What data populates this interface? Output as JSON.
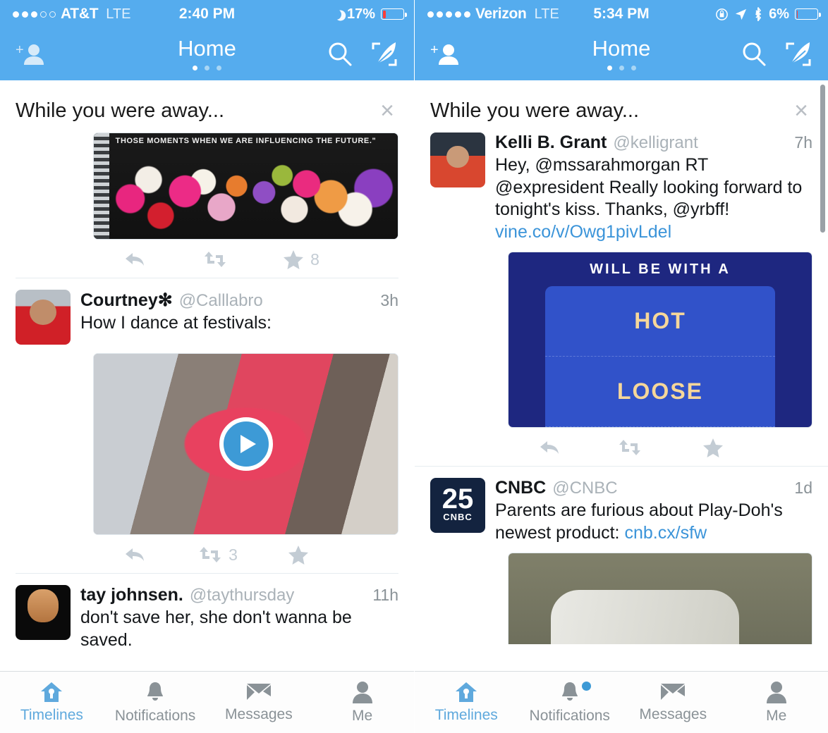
{
  "screens": [
    {
      "status": {
        "carrier": "AT&T",
        "network": "LTE",
        "time": "2:40 PM",
        "battery_percent": "17%",
        "signal_bars_filled": 3,
        "signal_bars_total": 5,
        "icons": [
          "moon-icon",
          "battery-icon"
        ],
        "battery_color": "#fc3d39"
      },
      "nav": {
        "title": "Home",
        "page_dot_active_index": 0,
        "page_dots": 3,
        "left_icon": "add-person-icon",
        "right_icons": [
          "search-icon",
          "compose-icon"
        ]
      },
      "section": {
        "title": "While you were away...",
        "close_label": "×"
      },
      "tweets": [
        {
          "name": "",
          "handle": "",
          "time": "",
          "text": "",
          "media": "flowers-notebook-image",
          "media_caption": "THOSE MOMENTS WHEN WE ARE INFLUENCING THE FUTURE.\"",
          "actions": {
            "reply": "",
            "retweet": "",
            "favorite": "8"
          }
        },
        {
          "name": "Courtney✻",
          "handle": "@Calllabro",
          "time": "3h",
          "text": "How I dance at festivals:",
          "media": "dance-video",
          "actions": {
            "reply": "",
            "retweet": "3",
            "favorite": ""
          }
        },
        {
          "name": "tay johnsen.",
          "handle": "@taythursday",
          "time": "11h",
          "text": "don't save her, she don't wanna be saved.",
          "media": "",
          "actions": {
            "reply": "",
            "retweet": "",
            "favorite": ""
          }
        }
      ],
      "tabs": [
        {
          "label": "Timelines",
          "icon": "home-icon",
          "active": true,
          "badge": false
        },
        {
          "label": "Notifications",
          "icon": "bell-icon",
          "active": false,
          "badge": false
        },
        {
          "label": "Messages",
          "icon": "envelope-icon",
          "active": false,
          "badge": false
        },
        {
          "label": "Me",
          "icon": "person-icon",
          "active": false,
          "badge": false
        }
      ]
    },
    {
      "status": {
        "carrier": "Verizon",
        "network": "LTE",
        "time": "5:34 PM",
        "battery_percent": "6%",
        "signal_bars_filled": 5,
        "signal_bars_total": 5,
        "icons": [
          "rotation-lock-icon",
          "location-arrow-icon",
          "bluetooth-icon",
          "battery-icon"
        ],
        "battery_color": "#fc3d39"
      },
      "nav": {
        "title": "Home",
        "page_dot_active_index": 0,
        "page_dots": 3,
        "left_icon": "add-person-icon",
        "right_icons": [
          "search-icon",
          "compose-icon"
        ]
      },
      "section": {
        "title": "While you were away...",
        "close_label": "×"
      },
      "tweets": [
        {
          "name": "Kelli B. Grant",
          "handle": "@kelligrant",
          "time": "7h",
          "text": "Hey, @mssarahmorgan RT @expresident Really looking forward to tonight's kiss. Thanks, @yrbff! ",
          "link": "vine.co/v/Owg1pivLdel",
          "media": "vine-hot-loose-image",
          "media_lines": [
            "WILL BE WITH A",
            "HOT",
            "LOOSE"
          ],
          "actions": {
            "reply": "",
            "retweet": "",
            "favorite": ""
          }
        },
        {
          "name": "CNBC",
          "handle": "@CNBC",
          "time": "1d",
          "text": "Parents are furious about Play-Doh's newest product: ",
          "link": "cnb.cx/sfw",
          "media": "playdoh-image",
          "actions": {
            "reply": "",
            "retweet": "",
            "favorite": ""
          }
        }
      ],
      "tabs": [
        {
          "label": "Timelines",
          "icon": "home-icon",
          "active": true,
          "badge": false
        },
        {
          "label": "Notifications",
          "icon": "bell-icon",
          "active": false,
          "badge": true
        },
        {
          "label": "Messages",
          "icon": "envelope-icon",
          "active": false,
          "badge": false
        },
        {
          "label": "Me",
          "icon": "person-icon",
          "active": false,
          "badge": false
        }
      ]
    }
  ],
  "theme": {
    "accent": "#55acee",
    "link": "#3b94d9",
    "muted": "#aab2b8",
    "icon_grey": "#c3ccd4",
    "tab_inactive": "#8a9297",
    "tab_active": "#5fa9dd"
  }
}
